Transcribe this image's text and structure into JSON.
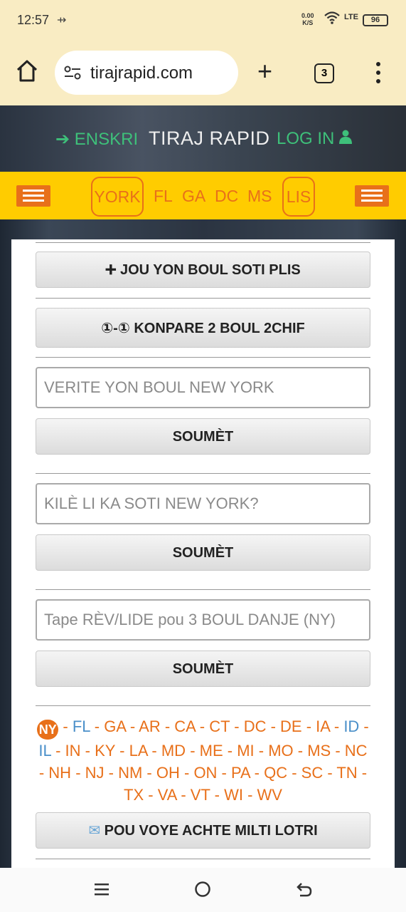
{
  "status_bar": {
    "time": "12:57",
    "net_speed_top": "0.00",
    "net_speed_bottom": "K/S",
    "network": "LTE",
    "battery": "96"
  },
  "browser": {
    "url": "tirajrapid.com",
    "tab_count": "3"
  },
  "header": {
    "signup": "ENSKRI",
    "title": "TIRAJ RAPID",
    "login": "LOG IN"
  },
  "nav": {
    "items": [
      "YORK",
      "FL",
      "GA",
      "DC",
      "MS",
      "LIS"
    ]
  },
  "actions": {
    "add_number": "JOU YON BOUL SOTI PLIS",
    "compare": "①-① KONPARE 2 BOUL 2CHIF",
    "verify_placeholder": "VERITE YON BOUL NEW YORK",
    "drawn_placeholder": "KILÈ LI KA SOTI NEW YORK?",
    "dream_placeholder": "Tape RÈV/LIDE pou 3 BOUL DANJE (NY)",
    "submit": "SOUMÈT",
    "buy_multi": "POU VOYE ACHTE MILTI LOTRI"
  },
  "states": {
    "current": "NY",
    "list": [
      "FL",
      "GA",
      "AR",
      "CA",
      "CT",
      "DC",
      "DE",
      "IA",
      "ID",
      "IL",
      "IN",
      "KY",
      "LA",
      "MD",
      "ME",
      "MI",
      "MO",
      "MS",
      "NC",
      "NH",
      "NJ",
      "NM",
      "OH",
      "ON",
      "PA",
      "QC",
      "SC",
      "TN",
      "TX",
      "VA",
      "VT",
      "WI",
      "WV"
    ],
    "blue_items": [
      "FL",
      "ID",
      "IL"
    ]
  },
  "colors": {
    "accent_orange": "#e8701a",
    "nav_yellow": "#ffcc00",
    "green": "#3ec07a",
    "chrome_bg": "#f9ecc3"
  }
}
